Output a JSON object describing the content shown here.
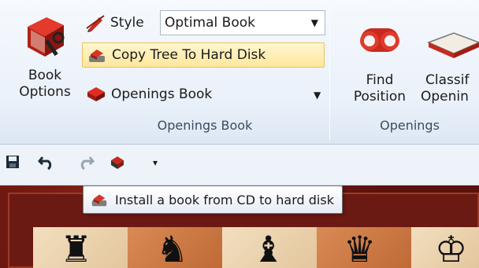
{
  "ribbon": {
    "book_group": {
      "book_options_line1": "Book",
      "book_options_line2": "Options",
      "style_label": "Style",
      "style_value": "Optimal Book",
      "copy_tree_label": "Copy Tree To Hard Disk",
      "openings_book_label": "Openings Book",
      "group_label": "Openings Book"
    },
    "openings_group": {
      "find_line1": "Find",
      "find_line2": "Position",
      "classify_line1": "Classif",
      "classify_line2": "Openin",
      "group_label": "Openings"
    }
  },
  "tooltip": {
    "text": "Install a book from CD to hard disk"
  },
  "colors": {
    "ribbon_bg": "#eaf1fa",
    "highlight": "#ffe79c",
    "board_frame": "#6a1a12"
  }
}
